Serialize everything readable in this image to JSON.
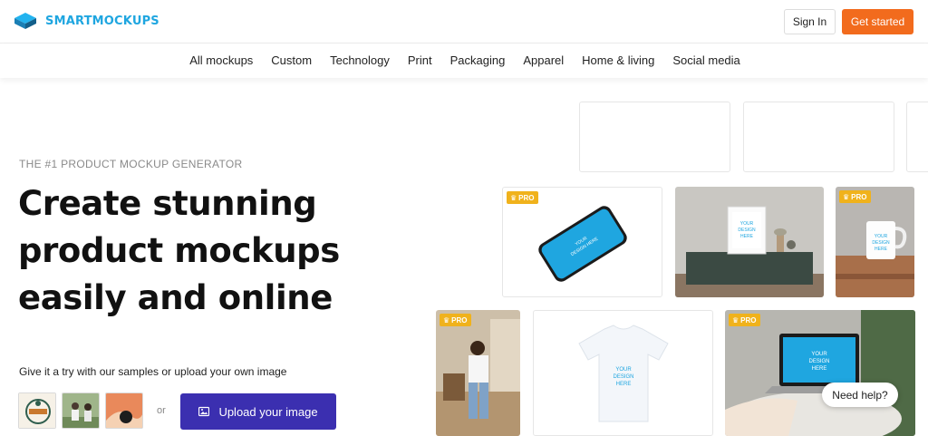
{
  "header": {
    "brand": "SMARTMOCKUPS",
    "sign_in": "Sign In",
    "get_started": "Get started"
  },
  "nav": {
    "items": [
      "All mockups",
      "Custom",
      "Technology",
      "Print",
      "Packaging",
      "Apparel",
      "Home & living",
      "Social media"
    ]
  },
  "hero": {
    "eyebrow": "THE #1 PRODUCT MOCKUP GENERATOR",
    "headline_lines": [
      "Create stunning",
      "product mockups",
      "easily and online"
    ],
    "try_text": "Give it a try with our samples or upload your own image",
    "or": "or",
    "upload_label": "Upload your image"
  },
  "mockups": {
    "pro_label": "PRO",
    "design_text": "YOUR DESIGN HERE"
  },
  "help": {
    "label": "Need help?"
  },
  "colors": {
    "brand": "#1fa6e0",
    "accent": "#f26b1d",
    "upload": "#3b2fb0",
    "pro": "#f0b21c"
  }
}
